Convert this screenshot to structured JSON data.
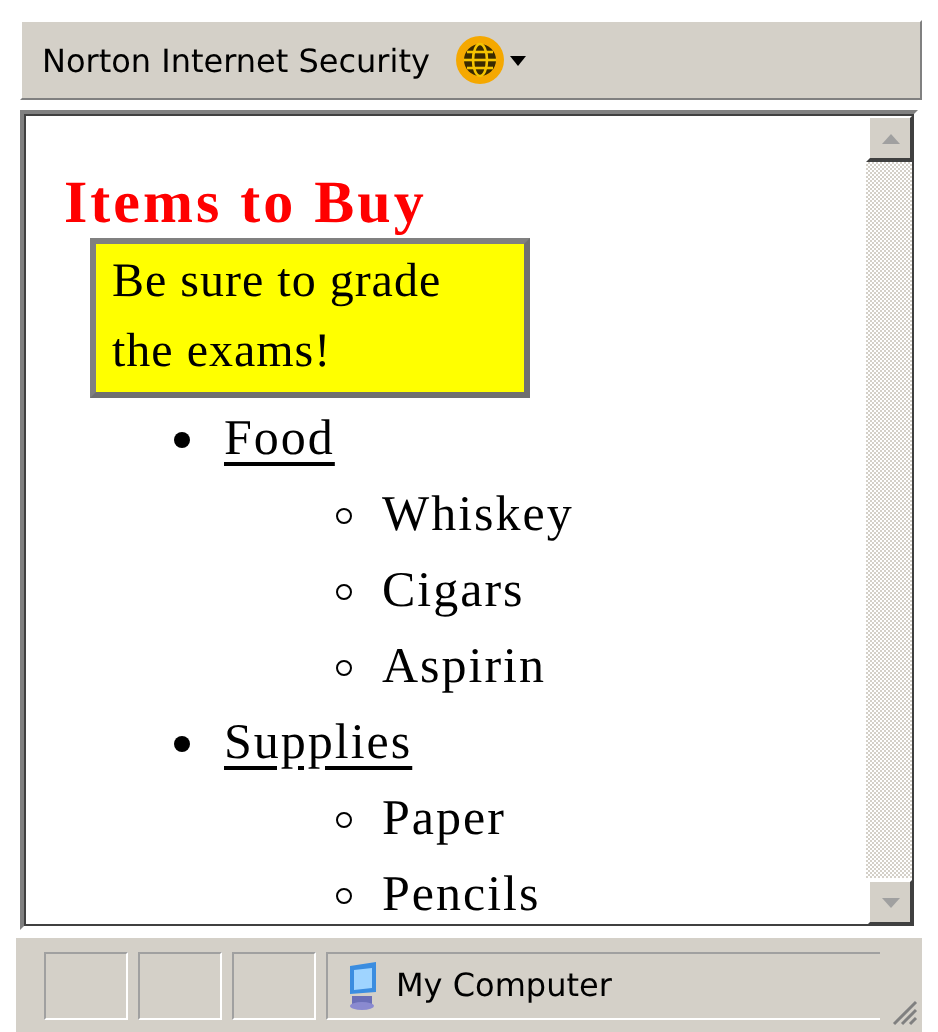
{
  "toolbar": {
    "label": "Norton Internet Security"
  },
  "page": {
    "heading": "Items to Buy",
    "note": "Be sure to grade the exams!",
    "list": [
      {
        "label": "Food",
        "link": true,
        "children": [
          {
            "label": "Whiskey"
          },
          {
            "label": "Cigars"
          },
          {
            "label": "Aspirin"
          }
        ]
      },
      {
        "label": "Supplies",
        "link": true,
        "children": [
          {
            "label": "Paper"
          },
          {
            "label": "Pencils"
          }
        ]
      }
    ]
  },
  "status_bar": {
    "zone": "My Computer"
  }
}
